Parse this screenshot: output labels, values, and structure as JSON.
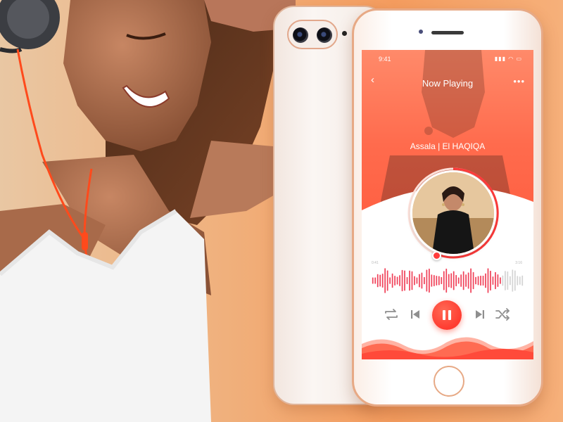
{
  "colors": {
    "accent": "#ff5a3c",
    "accent_light": "#ff8a6a",
    "rose_gold": "#e7a985",
    "waveform_played": "#f0435a",
    "waveform_unplayed": "#d4d4d4",
    "control_gray": "#8f8f8f"
  },
  "status_bar": {
    "time": "9:41",
    "icons": [
      "signal-icon",
      "wifi-icon",
      "battery-icon"
    ]
  },
  "player": {
    "back_icon": "chevron-left-icon",
    "title": "Now Playing",
    "more_icon": "more-dots-icon",
    "song": "Assala | El HAQIQA",
    "time_start": "0:41",
    "time_end": "3:16",
    "waveform_progress": 0.84,
    "controls": {
      "repeat_icon": "repeat-icon",
      "prev_icon": "skip-previous-icon",
      "pause_icon": "pause-icon",
      "next_icon": "skip-next-icon",
      "shuffle_icon": "shuffle-icon"
    }
  }
}
